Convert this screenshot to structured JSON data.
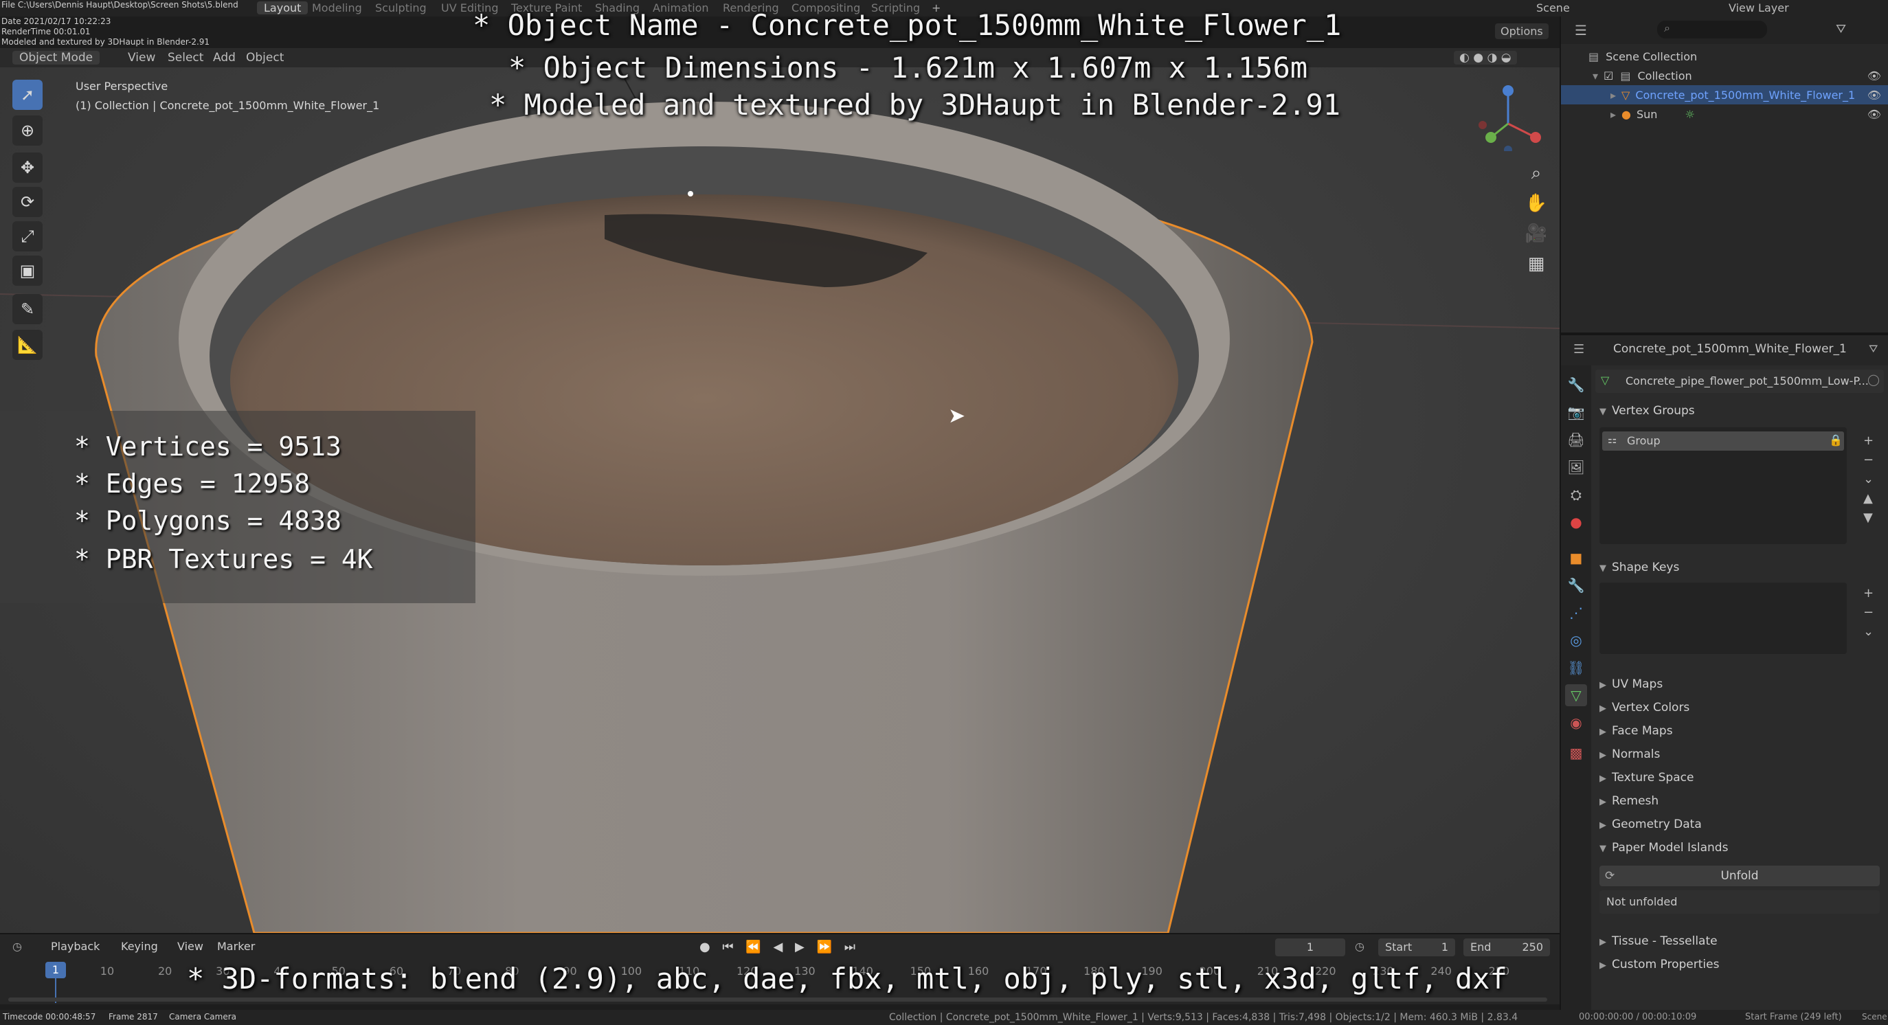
{
  "topbar": {
    "file_path": "File C:\\Users\\Dennis Haupt\\Desktop\\Screen Shots\\5.blend",
    "date": "Date 2021/02/17 10:22:23",
    "render_time": "RenderTime 00:01.01",
    "credit_small": "Modeled and textured by 3DHaupt in Blender-2.91",
    "workspaces": [
      "Layout",
      "Modeling",
      "Sculpting",
      "UV Editing",
      "Texture Paint",
      "Shading",
      "Animation",
      "Rendering",
      "Compositing",
      "Scripting"
    ],
    "add_workspace": "+",
    "scene": "Scene",
    "view_layer": "View Layer"
  },
  "header": {
    "mode": "Object Mode",
    "menu": [
      "View",
      "Select",
      "Add",
      "Object"
    ],
    "options": "Options"
  },
  "viewport": {
    "perspective": "User Perspective",
    "collection_info": "(1) Collection | Concrete_pot_1500mm_White_Flower_1"
  },
  "overlay": {
    "line1": "* Object Name - Concrete_pot_1500mm_White_Flower_1",
    "line2": "* Object Dimensions -  1.621m x 1.607m x 1.156m",
    "line3": "* Modeled and textured by 3DHaupt in Blender-2.91",
    "stats": [
      "* Vertices = 9513",
      "* Edges = 12958",
      "* Polygons = 4838",
      "* PBR Textures = 4K"
    ],
    "formats": "* 3D-formats: blend (2.9), abc, dae, fbx, mtl, obj, ply, stl, x3d, gltf, dxf"
  },
  "outliner": {
    "scene_collection": "Scene Collection",
    "collection": "Collection",
    "object": "Concrete_pot_1500mm_White_Flower_1",
    "sun": "Sun"
  },
  "properties": {
    "object_name": "Concrete_pot_1500mm_White_Flower_1",
    "mesh_name": "Concrete_pipe_flower_pot_1500mm_Low-P...",
    "vertex_groups": "Vertex Groups",
    "group_item": "Group",
    "shape_keys": "Shape Keys",
    "sections": [
      "UV Maps",
      "Vertex Colors",
      "Face Maps",
      "Normals",
      "Texture Space",
      "Remesh",
      "Geometry Data"
    ],
    "paper_model": "Paper Model Islands",
    "unfold": "Unfold",
    "not_unfolded": "Not unfolded",
    "tissue": "Tissue - Tessellate",
    "custom_props": "Custom Properties"
  },
  "timeline": {
    "menu": [
      "Playback",
      "Keying",
      "View",
      "Marker"
    ],
    "current_frame": "1",
    "start_label": "Start",
    "start": "1",
    "end_label": "End",
    "end": "250",
    "ticks": [
      "1",
      "10",
      "20",
      "30",
      "40",
      "50",
      "60",
      "70",
      "80",
      "90",
      "100",
      "110",
      "120",
      "130",
      "140",
      "150",
      "160",
      "170",
      "180",
      "190",
      "200",
      "210",
      "220",
      "230",
      "240",
      "250"
    ]
  },
  "statusbar": {
    "timecode": "Timecode 00:00:48:57",
    "frame": "Frame 2817",
    "camera": "Camera Camera",
    "stats": "Collection | Concrete_pot_1500mm_White_Flower_1 | Verts:9,513 | Faces:4,838 | Tris:7,498 | Objects:1/2 | Mem: 460.3 MiB | 2.83.4",
    "time": "00:00:00:00 / 00:00:10:09",
    "start_frame": "Start Frame (249 left)",
    "scene": "Scene"
  },
  "colors": {
    "accent": "#4772b3",
    "selection": "#e98c2b",
    "panel": "#2b2b2b"
  }
}
